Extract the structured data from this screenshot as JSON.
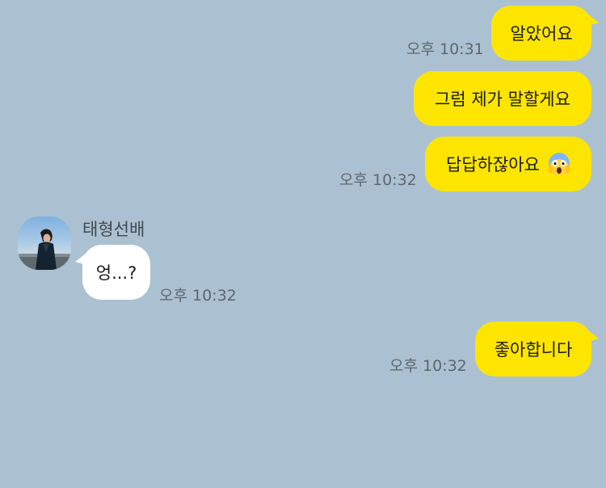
{
  "messages": [
    {
      "text": "알았어요",
      "time": "오후 10:31"
    },
    {
      "text": "그럼 제가 말할게요"
    },
    {
      "text": "답답하잖아요",
      "emoji": "screaming-face-icon",
      "time": "오후 10:32"
    },
    {
      "sender": "태형선배",
      "text": "엉...?",
      "time": "오후 10:32"
    },
    {
      "text": "좋아합니다",
      "time": "오후 10:32"
    }
  ],
  "colors": {
    "background": "#abc1d1",
    "my_bubble": "#fee500",
    "their_bubble": "#ffffff",
    "timestamp": "#5b6770"
  }
}
